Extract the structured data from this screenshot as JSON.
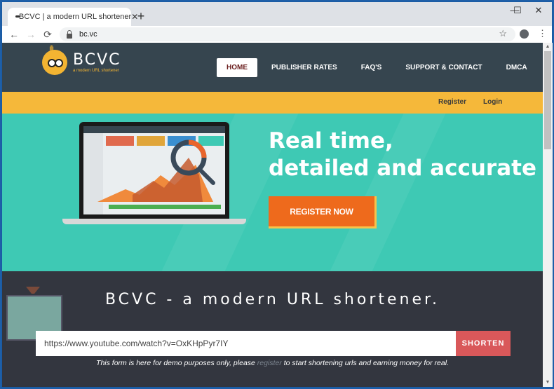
{
  "browser": {
    "tab_title": "BCVC | a modern URL shortener",
    "tab_close": "✕",
    "new_tab": "+",
    "url": "bc.vc",
    "controls": {
      "minimize": "—",
      "maximize": "☐",
      "close": "✕"
    },
    "nav": {
      "back": "←",
      "forward": "→",
      "reload": "⟳"
    },
    "star": "☆",
    "menu": "⋮"
  },
  "site": {
    "logo": {
      "name": "BCVC",
      "tagline": "a modern URL shortener"
    },
    "nav": [
      {
        "label": "HOME",
        "active": true
      },
      {
        "label": "PUBLISHER RATES",
        "active": false
      },
      {
        "label": "FAQ'S",
        "active": false
      },
      {
        "label": "SUPPORT & CONTACT",
        "active": false
      },
      {
        "label": "DMCA",
        "active": false
      }
    ],
    "auth": {
      "register": "Register",
      "login": "Login"
    },
    "hero": {
      "title_line1": "Real time,",
      "title_line2": "detailed and accurate",
      "cta": "REGISTER NOW"
    },
    "shortener": {
      "title": "BCVC - a modern URL shortener.",
      "input_value": "https://www.youtube.com/watch?v=OxKHpPyr7IY",
      "button": "SHORTEN",
      "note_before": "This form is here for demo purposes only, please ",
      "note_link": "register",
      "note_after": " to start shortening urls and earning money for real."
    }
  },
  "colors": {
    "header_bg": "#36454f",
    "yellow_bar": "#f5b83a",
    "hero_bg": "#3ec9b4",
    "cta_orange": "#ee6a1c",
    "shorten_red": "#d9585a",
    "shortener_bg": "#33363f"
  }
}
